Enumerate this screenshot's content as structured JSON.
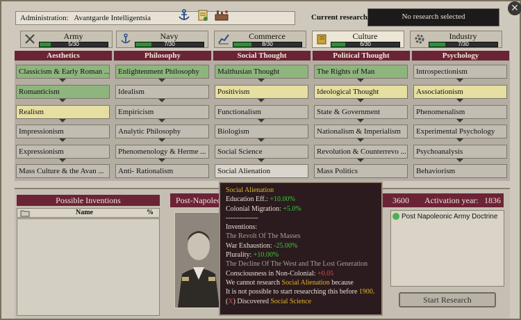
{
  "header": {
    "admin_label": "Administration:",
    "admin_value": "Avantgarde Intelligentsia",
    "current_research_label": "Current research:",
    "current_research_value": "No research selected",
    "close_glyph": "✕"
  },
  "toolbar_icons": [
    "anchor-icon",
    "scroll-icon",
    "factory-icon"
  ],
  "tabs": [
    {
      "name": "Army",
      "progress": "5/30",
      "done": 5,
      "total": 30,
      "icon": "crossed-swords-icon",
      "active": false
    },
    {
      "name": "Navy",
      "progress": "7/30",
      "done": 7,
      "total": 30,
      "icon": "anchor-icon",
      "active": false
    },
    {
      "name": "Commerce",
      "progress": "8/30",
      "done": 8,
      "total": 30,
      "icon": "chart-icon",
      "active": false
    },
    {
      "name": "Culture",
      "progress": "6/30",
      "done": 6,
      "total": 30,
      "icon": "book-icon",
      "active": true
    },
    {
      "name": "Industry",
      "progress": "7/30",
      "done": 7,
      "total": 30,
      "icon": "gear-icon",
      "active": false
    }
  ],
  "columns": [
    {
      "title": "Aesthetics",
      "techs": [
        {
          "name": "Classicism & Early Roman ...",
          "state": "green"
        },
        {
          "name": "Romanticism",
          "state": "green"
        },
        {
          "name": "Realism",
          "state": "yellow"
        },
        {
          "name": "Impressionism",
          "state": "grey"
        },
        {
          "name": "Expressionism",
          "state": "grey"
        },
        {
          "name": "Mass Culture & the Avan ...",
          "state": "grey"
        }
      ]
    },
    {
      "title": "Philosophy",
      "techs": [
        {
          "name": "Enlightenment Philosophy",
          "state": "green"
        },
        {
          "name": "Idealism",
          "state": "grey"
        },
        {
          "name": "Empiricism",
          "state": "grey"
        },
        {
          "name": "Analytic Philosophy",
          "state": "grey"
        },
        {
          "name": "Phenomenology & Herme ...",
          "state": "grey"
        },
        {
          "name": "Anti- Rationalism",
          "state": "grey"
        }
      ]
    },
    {
      "title": "Social Thought",
      "techs": [
        {
          "name": "Malthusian Thought",
          "state": "green"
        },
        {
          "name": "Positivism",
          "state": "yellow"
        },
        {
          "name": "Functionalism",
          "state": "grey"
        },
        {
          "name": "Biologism",
          "state": "grey"
        },
        {
          "name": "Social Science",
          "state": "grey"
        },
        {
          "name": "Social Alienation",
          "state": "light"
        }
      ]
    },
    {
      "title": "Political Thought",
      "techs": [
        {
          "name": "The Rights of Man",
          "state": "green"
        },
        {
          "name": "Ideological Thought",
          "state": "yellow"
        },
        {
          "name": "State & Government",
          "state": "grey"
        },
        {
          "name": "Nationalism & Imperialism",
          "state": "grey"
        },
        {
          "name": "Revolution & Counterrevo ...",
          "state": "grey"
        },
        {
          "name": "Mass Politics",
          "state": "grey"
        }
      ]
    },
    {
      "title": "Psychology",
      "techs": [
        {
          "name": "Introspectionism",
          "state": "grey"
        },
        {
          "name": "Associationism",
          "state": "yellow"
        },
        {
          "name": "Phenomenalism",
          "state": "grey"
        },
        {
          "name": "Experimental Psychology",
          "state": "grey"
        },
        {
          "name": "Psychoanalysis",
          "state": "grey"
        },
        {
          "name": "Behaviorism",
          "state": "grey"
        }
      ]
    }
  ],
  "inventions": {
    "title": "Possible Inventions",
    "col_name": "Name",
    "col_pct": "%"
  },
  "detail": {
    "title": "Post-Napoleonic Thought",
    "cost": "3600",
    "activation_label": "Activation year:",
    "activation_value": "1836",
    "unlocks": [
      "Post Napoleonic Army Doctrine"
    ],
    "start_button": "Start Research"
  },
  "tooltip": {
    "title": "Social Alienation",
    "lines": [
      [
        {
          "t": "Education Eff.: "
        },
        {
          "t": "+10.00%",
          "c": "g"
        }
      ],
      [
        {
          "t": "Colonial Migration: "
        },
        {
          "t": "+5.0%",
          "c": "g"
        }
      ],
      [
        {
          "t": "--------------"
        }
      ],
      [
        {
          "t": "Inventions:"
        }
      ],
      [
        {
          "t": "The Revolt Of The Masses",
          "c": "dim"
        }
      ],
      [
        {
          "t": "War Exhaustion: "
        },
        {
          "t": "-25.00%",
          "c": "g"
        }
      ],
      [
        {
          "t": "Plurality: "
        },
        {
          "t": "+10.00%",
          "c": "g"
        }
      ],
      [
        {
          "t": "The Decline Of The West and The Lost Generation",
          "c": "dim"
        }
      ],
      [
        {
          "t": "Consciousness in Non-Colonial: "
        },
        {
          "t": "+0.05",
          "c": "r"
        }
      ],
      [
        {
          "t": " "
        }
      ],
      [
        {
          "t": "We cannot research "
        },
        {
          "t": "Social Alienation",
          "c": "y"
        },
        {
          "t": " because"
        }
      ],
      [
        {
          "t": "It is not possible to start researching this before "
        },
        {
          "t": "1900",
          "c": "y"
        },
        {
          "t": "."
        }
      ],
      [
        {
          "t": "(",
          "c": ""
        },
        {
          "t": "X",
          "c": "r"
        },
        {
          "t": ") Discovered "
        },
        {
          "t": "Social Science",
          "c": "y"
        }
      ]
    ]
  }
}
